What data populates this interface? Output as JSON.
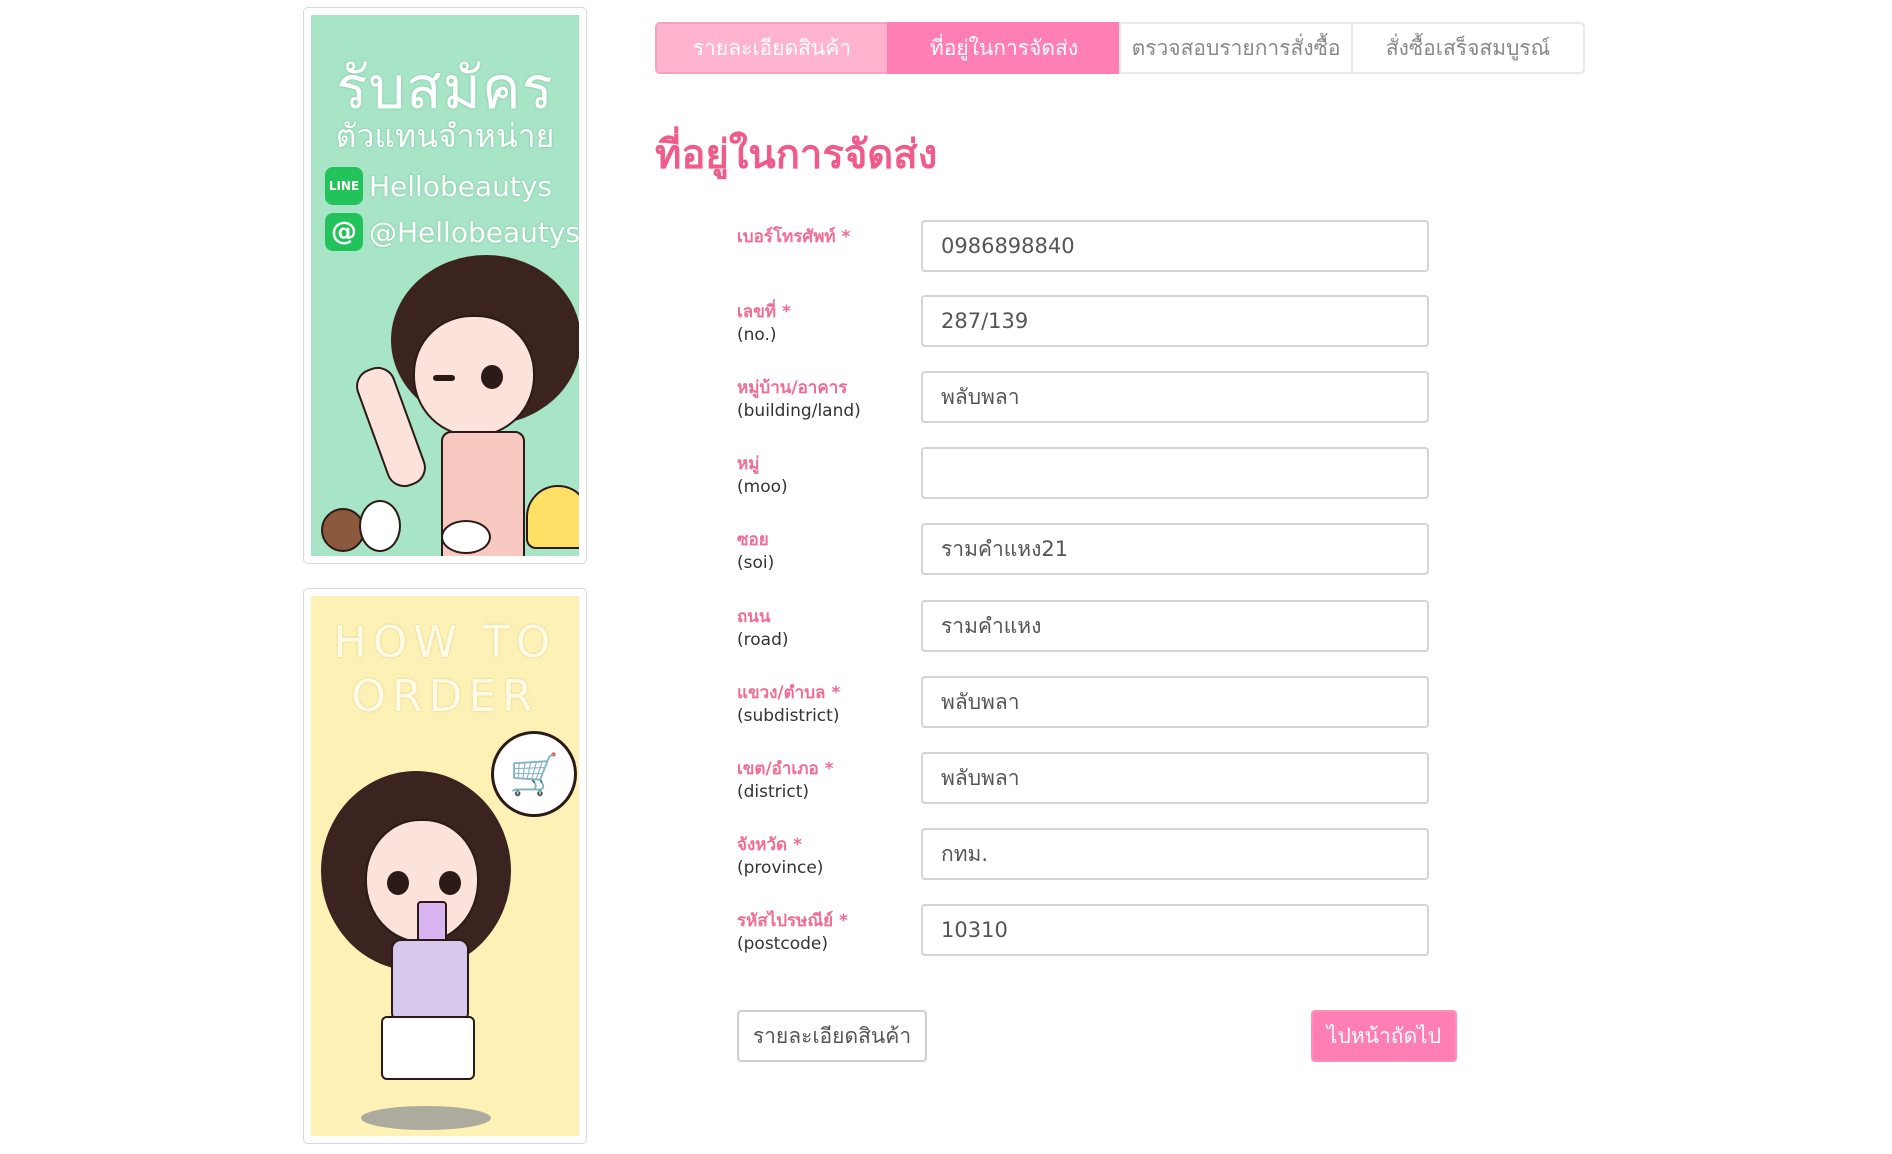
{
  "sidebar": {
    "banner1": {
      "title": "รับสมัคร",
      "subtitle": "ตัวแทนจำหน่าย",
      "line_id": "Hellobeautys",
      "line_icon": "LINE",
      "at_id": "@Hellobeautys",
      "at_icon": "@"
    },
    "banner2": {
      "title": "HOW TO ORDER"
    }
  },
  "tabs": [
    {
      "label": "รายละเอียดสินค้า",
      "state": "done"
    },
    {
      "label": "ที่อยู่ในการจัดส่ง",
      "state": "active"
    },
    {
      "label": "ตรวจสอบรายการสั่งซื้อ",
      "state": "pending"
    },
    {
      "label": "สั่งซื้อเสร็จสมบูรณ์",
      "state": "pending"
    }
  ],
  "page_title": "ที่อยู่ในการจัดส่ง",
  "form": {
    "phone": {
      "label_th": "เบอร์โทรศัพท์ *",
      "label_en": "",
      "value": "0986898840"
    },
    "no": {
      "label_th": "เลขที่ *",
      "label_en": "(no.)",
      "value": "287/139"
    },
    "building": {
      "label_th": "หมู่บ้าน/อาคาร",
      "label_en": "(building/land)",
      "value": "พลับพลา"
    },
    "moo": {
      "label_th": "หมู่",
      "label_en": "(moo)",
      "value": ""
    },
    "soi": {
      "label_th": "ซอย",
      "label_en": "(soi)",
      "value": "รามคำแหง21"
    },
    "road": {
      "label_th": "ถนน",
      "label_en": "(road)",
      "value": "รามคำแหง"
    },
    "subdistrict": {
      "label_th": "แขวง/ตำบล *",
      "label_en": "(subdistrict)",
      "value": "พลับพลา"
    },
    "district": {
      "label_th": "เขต/อำเภอ *",
      "label_en": "(district)",
      "value": "พลับพลา"
    },
    "province": {
      "label_th": "จังหวัด *",
      "label_en": "(province)",
      "value": "กทม."
    },
    "postcode": {
      "label_th": "รหัสไปรษณีย์ *",
      "label_en": "(postcode)",
      "value": "10310"
    }
  },
  "buttons": {
    "back": "รายละเอียดสินค้า",
    "next": "ไปหน้าถัดไป"
  },
  "colors": {
    "accent": "#ff7eb3",
    "accent_light": "#ffb3cf",
    "label": "#ef6d95",
    "title": "#ef5b8a"
  }
}
